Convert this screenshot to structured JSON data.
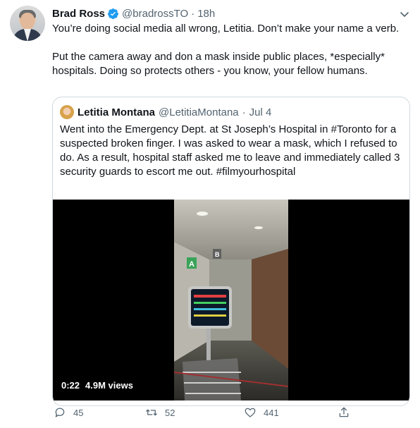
{
  "tweet": {
    "author_name": "Brad Ross",
    "author_handle": "@bradrossTO",
    "separator": "·",
    "time": "18h",
    "paragraphs": [
      "You’re doing social media all wrong, Letitia. Don’t make your name a verb.",
      "Put the camera away and don a mask inside public places, *especially* hospitals. Doing so protects others - you know, your fellow humans."
    ]
  },
  "quoted": {
    "author_name": "Letitia Montana",
    "author_handle": "@LetitiaMontana",
    "separator": "·",
    "date": "Jul 4",
    "text": "Went into the Emergency Dept. at St Joseph’s Hospital in #Toronto for a suspected broken finger. I was asked to wear a mask, which I refused to do. As a result, hospital staff asked me to leave and immediately called 3 security guards to escort me out. #filmyourhospital",
    "video": {
      "duration": "0:22",
      "views": "4.9M views",
      "sign_letters": [
        "A",
        "B"
      ]
    }
  },
  "actions": {
    "replies": "45",
    "retweets": "52",
    "likes": "441"
  },
  "colors": {
    "verified": "#1d9bf0",
    "secondary_text": "#536471",
    "border": "#cfd9de"
  }
}
